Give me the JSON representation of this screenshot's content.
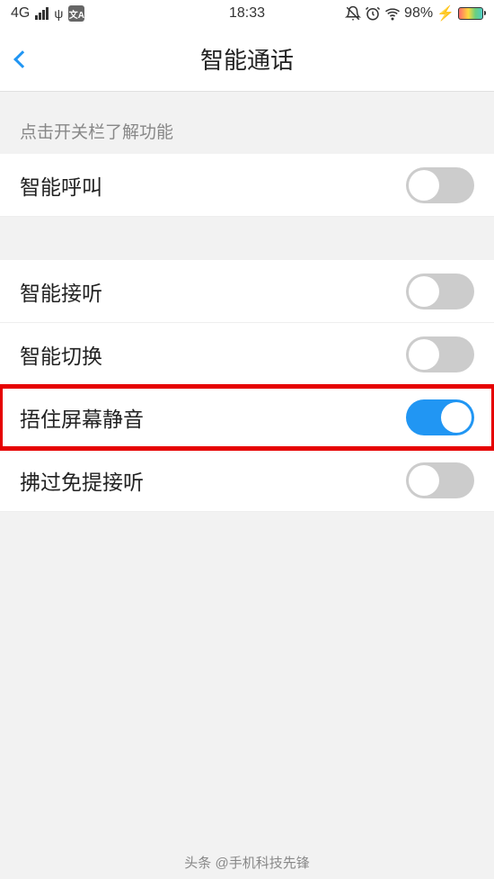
{
  "status_bar": {
    "network": "4G",
    "time": "18:33",
    "battery_percent": "98%",
    "mute_icon": "🔕",
    "alarm_icon": "⏰",
    "wifi_icon": "📶",
    "charge_icon": "⚡",
    "usb_icon": "ψ",
    "translate_icon": "文A"
  },
  "header": {
    "title": "智能通话"
  },
  "section": {
    "hint": "点击开关栏了解功能"
  },
  "rows": {
    "smart_call": {
      "label": "智能呼叫",
      "on": false
    },
    "smart_answer": {
      "label": "智能接听",
      "on": false
    },
    "smart_switch": {
      "label": "智能切换",
      "on": false
    },
    "cover_mute": {
      "label": "捂住屏幕静音",
      "on": true
    },
    "wave_speaker": {
      "label": "拂过免提接听",
      "on": false
    }
  },
  "caption": "头条 @手机科技先锋"
}
